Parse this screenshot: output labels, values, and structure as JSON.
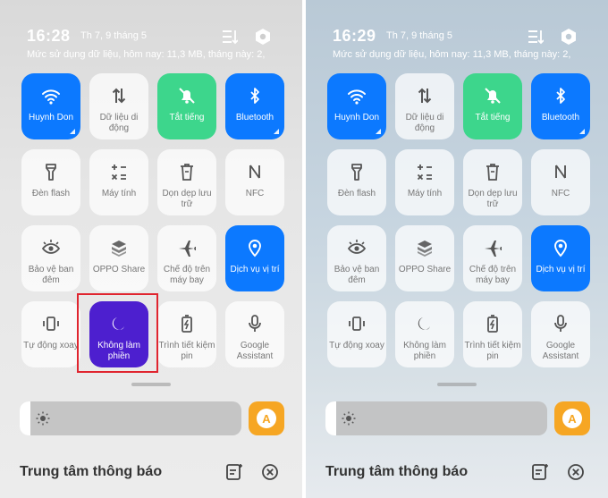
{
  "screens": [
    {
      "time": "16:28",
      "date": "Th 7, 9 tháng 5",
      "data_usage": "Mức sử dụng dữ liệu, hôm nay: 11,3 MB, tháng này: 2,",
      "tiles": [
        {
          "label": "Huynh Don",
          "icon": "wifi-icon",
          "state": "on-blue"
        },
        {
          "label": "Dữ liệu di động",
          "icon": "mobile-data-icon",
          "state": "off"
        },
        {
          "label": "Tắt tiếng",
          "icon": "mute-bell-icon",
          "state": "on-green"
        },
        {
          "label": "Bluetooth",
          "icon": "bluetooth-icon",
          "state": "on-blue"
        },
        {
          "label": "Đèn flash",
          "icon": "flashlight-icon",
          "state": "off"
        },
        {
          "label": "Máy tính",
          "icon": "calculator-icon",
          "state": "off"
        },
        {
          "label": "Dọn dẹp lưu trữ",
          "icon": "trash-icon",
          "state": "off"
        },
        {
          "label": "NFC",
          "icon": "nfc-icon",
          "state": "off"
        },
        {
          "label": "Bảo vệ ban đêm",
          "icon": "eye-icon",
          "state": "off"
        },
        {
          "label": "OPPO Share",
          "icon": "oppo-share-icon",
          "state": "off"
        },
        {
          "label": "Chế độ trên máy bay",
          "icon": "airplane-icon",
          "state": "off"
        },
        {
          "label": "Dịch vụ vị trí",
          "icon": "location-icon",
          "state": "on-blue"
        },
        {
          "label": "Tự động xoay",
          "icon": "auto-rotate-icon",
          "state": "off"
        },
        {
          "label": "Không làm phiền",
          "icon": "moon-icon",
          "state": "on-purple"
        },
        {
          "label": "Trình tiết kiệm pin",
          "icon": "battery-saver-icon",
          "state": "off"
        },
        {
          "label": "Google Assistant",
          "icon": "microphone-icon",
          "state": "off"
        }
      ],
      "brightness": 0.05,
      "auto_brightness_label": "A",
      "notification_title": "Trung tâm thông báo"
    },
    {
      "time": "16:29",
      "date": "Th 7, 9 tháng 5",
      "data_usage": "Mức sử dụng dữ liệu, hôm nay: 11,3 MB, tháng này: 2,",
      "tiles": [
        {
          "label": "Huynh Don",
          "icon": "wifi-icon",
          "state": "on-blue"
        },
        {
          "label": "Dữ liệu di động",
          "icon": "mobile-data-icon",
          "state": "off"
        },
        {
          "label": "Tắt tiếng",
          "icon": "mute-bell-icon",
          "state": "on-green"
        },
        {
          "label": "Bluetooth",
          "icon": "bluetooth-icon",
          "state": "on-blue"
        },
        {
          "label": "Đèn flash",
          "icon": "flashlight-icon",
          "state": "off"
        },
        {
          "label": "Máy tính",
          "icon": "calculator-icon",
          "state": "off"
        },
        {
          "label": "Dọn dẹp lưu trữ",
          "icon": "trash-icon",
          "state": "off"
        },
        {
          "label": "NFC",
          "icon": "nfc-icon",
          "state": "off"
        },
        {
          "label": "Bảo vệ ban đêm",
          "icon": "eye-icon",
          "state": "off"
        },
        {
          "label": "OPPO Share",
          "icon": "oppo-share-icon",
          "state": "off"
        },
        {
          "label": "Chế độ trên máy bay",
          "icon": "airplane-icon",
          "state": "off"
        },
        {
          "label": "Dịch vụ vị trí",
          "icon": "location-icon",
          "state": "on-blue"
        },
        {
          "label": "Tự động xoay",
          "icon": "auto-rotate-icon",
          "state": "off"
        },
        {
          "label": "Không làm phiền",
          "icon": "moon-icon",
          "state": "off"
        },
        {
          "label": "Trình tiết kiệm pin",
          "icon": "battery-saver-icon",
          "state": "off"
        },
        {
          "label": "Google Assistant",
          "icon": "microphone-icon",
          "state": "off"
        }
      ],
      "brightness": 0.05,
      "auto_brightness_label": "A",
      "notification_title": "Trung tâm thông báo"
    }
  ],
  "colors": {
    "tile_blue": "#0c79ff",
    "tile_green": "#3dd68c",
    "tile_purple": "#4d1fcf",
    "auto_orange": "#f6a623",
    "highlight_red": "#e0252f"
  }
}
